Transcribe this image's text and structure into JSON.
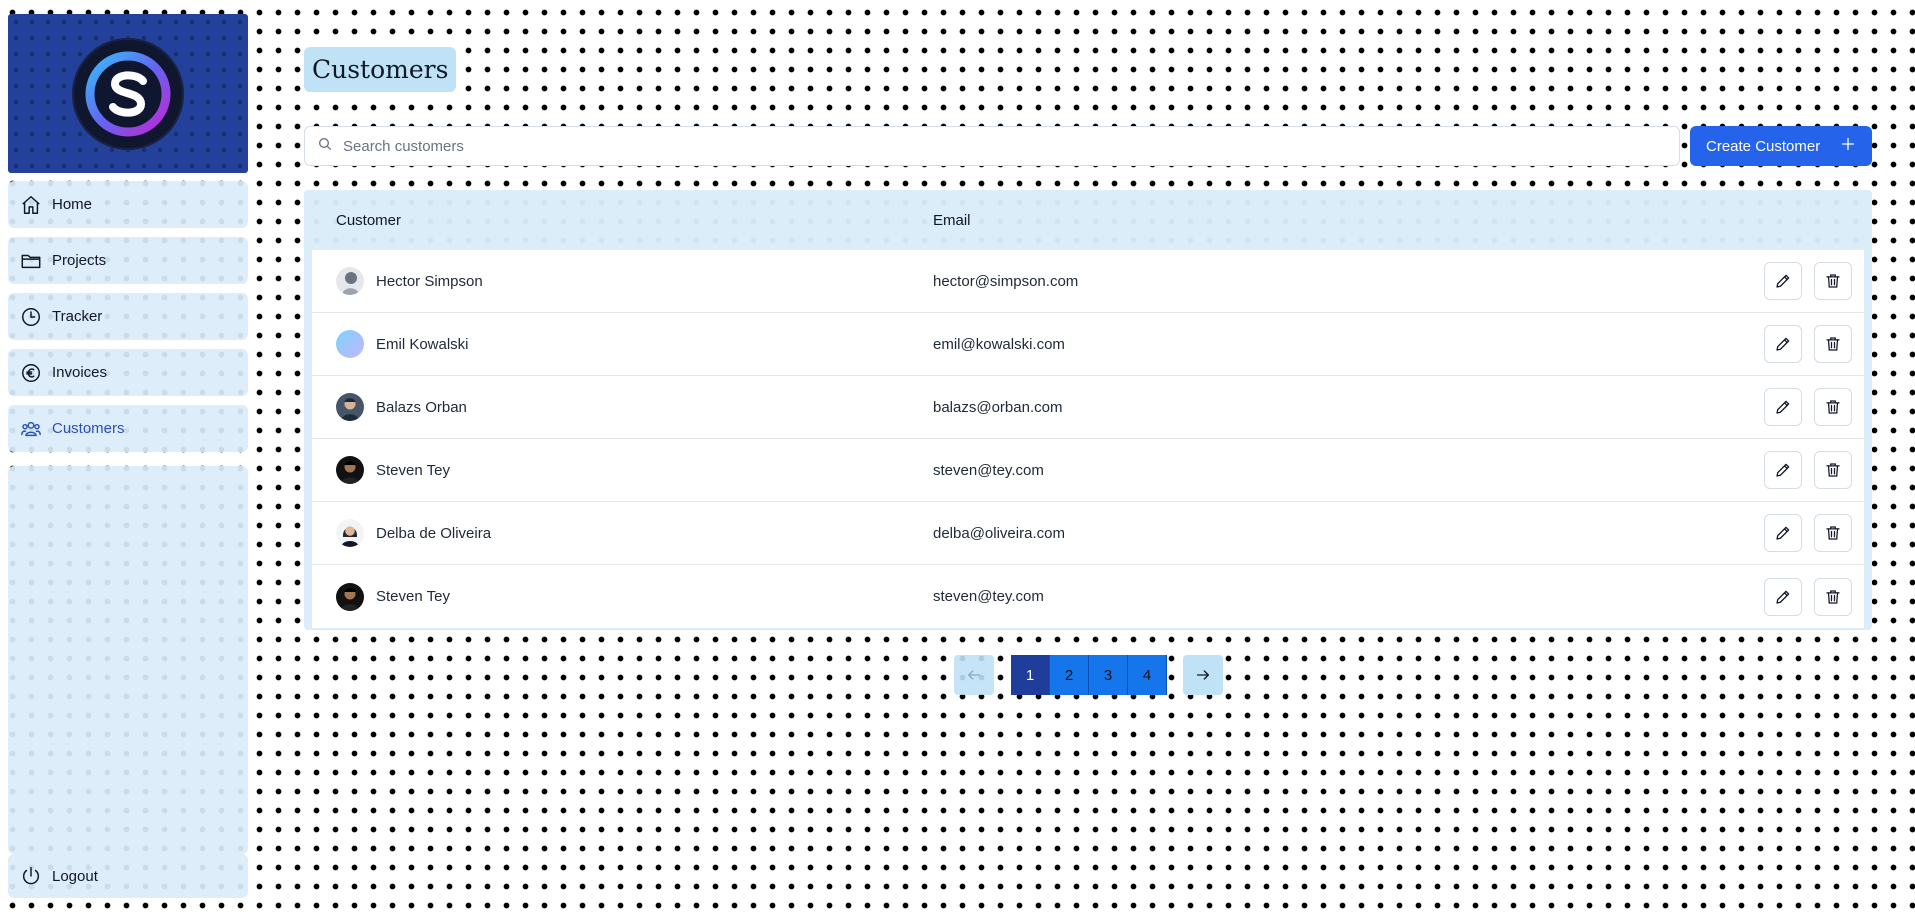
{
  "sidebar": {
    "logo_letter": "S",
    "items": [
      {
        "label": "Home",
        "icon": "home-icon"
      },
      {
        "label": "Projects",
        "icon": "folder-icon"
      },
      {
        "label": "Tracker",
        "icon": "clock-icon"
      },
      {
        "label": "Invoices",
        "icon": "euro-icon"
      },
      {
        "label": "Customers",
        "icon": "users-icon",
        "active": true
      }
    ],
    "logout_label": "Logout"
  },
  "main": {
    "title": "Customers",
    "search": {
      "placeholder": "Search customers",
      "value": ""
    },
    "create_button_label": "Create Customer",
    "table": {
      "columns": [
        "Customer",
        "Email"
      ],
      "rows": [
        {
          "name": "Hector Simpson",
          "email": "hector@simpson.com",
          "avatar": "avatar-gray"
        },
        {
          "name": "Emil Kowalski",
          "email": "emil@kowalski.com",
          "avatar": "avatar-gradient"
        },
        {
          "name": "Balazs Orban",
          "email": "balazs@orban.com",
          "avatar": "avatar-photo"
        },
        {
          "name": "Steven Tey",
          "email": "steven@tey.com",
          "avatar": "avatar-photo-dark"
        },
        {
          "name": "Delba de Oliveira",
          "email": "delba@oliveira.com",
          "avatar": "avatar-photo-light"
        },
        {
          "name": "Steven Tey",
          "email": "steven@tey.com",
          "avatar": "avatar-photo-dark"
        }
      ]
    },
    "pagination": {
      "pages": [
        "1",
        "2",
        "3",
        "4"
      ],
      "current": "1"
    }
  },
  "colors": {
    "accent": "#2563eb",
    "sidebar_brand": "#23419a",
    "active_nav": "#2b4fb8",
    "panel": "#dbecfa"
  }
}
